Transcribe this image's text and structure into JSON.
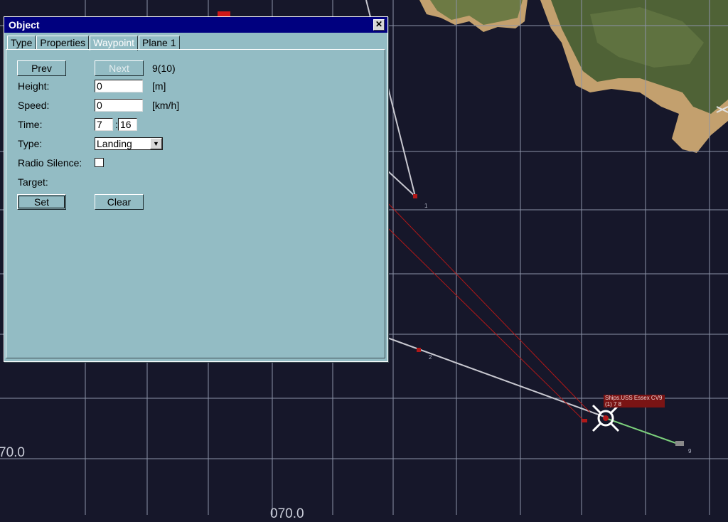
{
  "dialog": {
    "title": "Object",
    "close_glyph": "✕",
    "tabs": [
      {
        "label": "Type"
      },
      {
        "label": "Properties"
      },
      {
        "label": "Waypoint"
      },
      {
        "label": "Plane 1"
      }
    ],
    "active_tab": "Waypoint"
  },
  "waypoint": {
    "prev_label": "Prev",
    "next_label": "Next",
    "index_display": "9(10)",
    "height_label": "Height:",
    "height_value": "0",
    "height_unit": "[m]",
    "speed_label": "Speed:",
    "speed_value": "0",
    "speed_unit": "[km/h]",
    "time_label": "Time:",
    "time_hour": "7",
    "time_sep": ":",
    "time_minute": "16",
    "type_label": "Type:",
    "type_value": "Landing",
    "radio_label": "Radio Silence:",
    "radio_checked": false,
    "target_label": "Target:",
    "set_label": "Set",
    "clear_label": "Clear"
  },
  "map": {
    "coord_left": "70.0",
    "coord_bottom": "070.0",
    "ship_label_line1": "Ships.USS Essex CV9",
    "ship_label_line2": "(1) 7  8",
    "waypoint_labels": [
      "1",
      "2",
      "9"
    ],
    "colors": {
      "sea": "#16172a",
      "grid": "#8c93a8",
      "route": "#c8c8d0",
      "red_route": "#b01818",
      "green_route": "#7cd07c",
      "land": "#5a6a3a",
      "beach": "#c09a6a"
    }
  }
}
